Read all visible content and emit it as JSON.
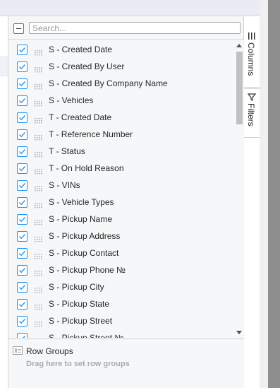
{
  "search": {
    "placeholder": "Search..."
  },
  "columns": [
    {
      "label": "S - Created Date",
      "checked": true
    },
    {
      "label": "S - Created By User",
      "checked": true
    },
    {
      "label": "S - Created By Company Name",
      "checked": true
    },
    {
      "label": "S - Vehicles",
      "checked": true
    },
    {
      "label": "T - Created Date",
      "checked": true
    },
    {
      "label": "T - Reference Number",
      "checked": true
    },
    {
      "label": "T - Status",
      "checked": true
    },
    {
      "label": "T - On Hold Reason",
      "checked": true
    },
    {
      "label": "S - VINs",
      "checked": true
    },
    {
      "label": "S - Vehicle Types",
      "checked": true
    },
    {
      "label": "S - Pickup Name",
      "checked": true
    },
    {
      "label": "S - Pickup Address",
      "checked": true
    },
    {
      "label": "S - Pickup Contact",
      "checked": true
    },
    {
      "label": "S - Pickup Phone №",
      "checked": true
    },
    {
      "label": "S - Pickup City",
      "checked": true
    },
    {
      "label": "S - Pickup State",
      "checked": true
    },
    {
      "label": "S - Pickup Street",
      "checked": true
    },
    {
      "label": "S - Pickup Street №",
      "checked": true
    }
  ],
  "row_groups": {
    "title": "Row Groups",
    "empty_message": "Drag here to set row groups",
    "icon": "row-groups-icon"
  },
  "side_tabs": {
    "columns": {
      "label": "Columns",
      "icon": "columns-icon"
    },
    "filters": {
      "label": "Filters",
      "icon": "filter-icon"
    }
  },
  "colors": {
    "checkbox_accent": "#2196f3",
    "panel_bg": "#f6f7f8",
    "scrollbar_thumb": "#c1c1c1"
  }
}
